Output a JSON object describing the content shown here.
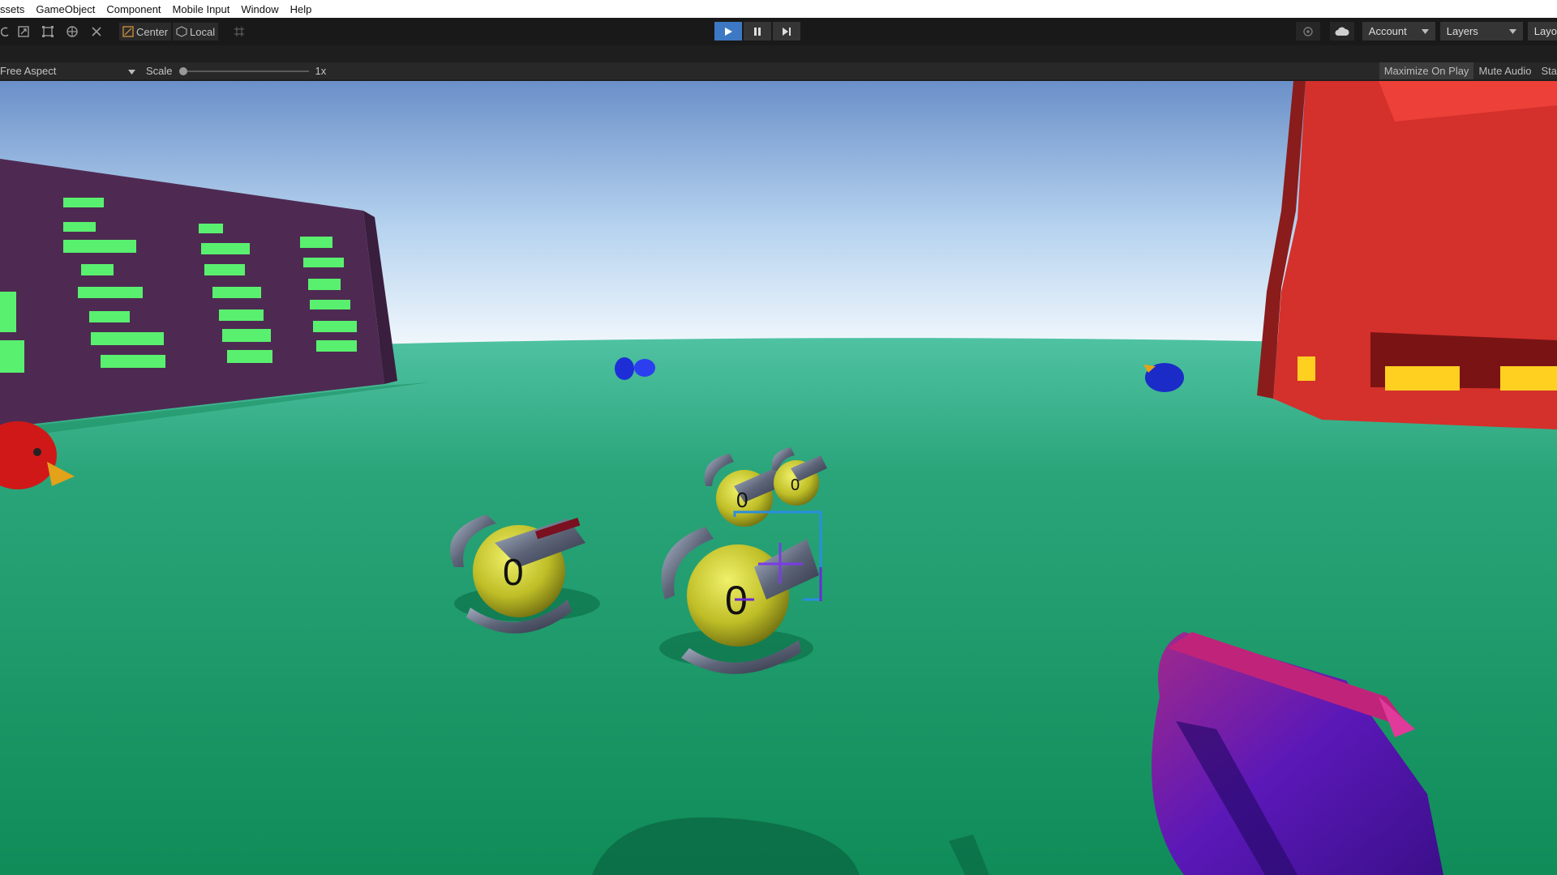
{
  "menu": [
    "ssets",
    "GameObject",
    "Component",
    "Mobile Input",
    "Window",
    "Help"
  ],
  "toolbar": {
    "center_label": "Center",
    "local_label": "Local",
    "account_label": "Account",
    "layers_label": "Layers",
    "layout_label": "Layo"
  },
  "game_bar": {
    "aspect_label": "Free Aspect",
    "scale_label": "Scale",
    "scale_value": "1x",
    "maximize_label": "Maximize On Play",
    "mute_label": "Mute Audio",
    "stats_label": "Sta"
  },
  "scene": {
    "sky_top": "#6b90c9",
    "grass": "#1f9a6b",
    "building_left": "#4e2a52",
    "building_window": "#59f06f",
    "building_right": "#d4302c",
    "robot_labels": [
      "0",
      "0",
      "0",
      "0"
    ]
  },
  "playback": {
    "playing": true
  }
}
